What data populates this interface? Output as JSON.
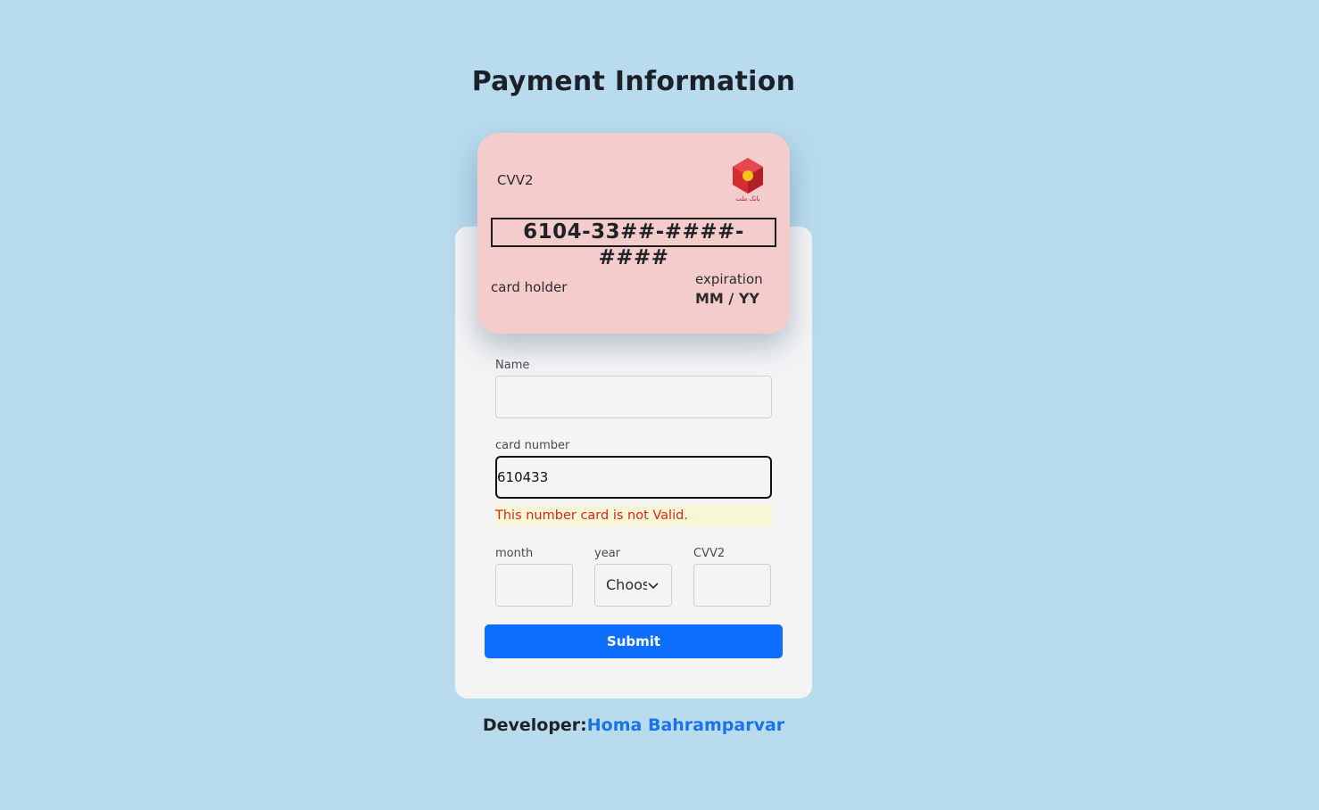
{
  "page": {
    "title": "Payment Information"
  },
  "card_preview": {
    "cvv_label": "CVV2",
    "number": "6104-33##-####-####",
    "holder": "card holder",
    "expiration_label": "expiration",
    "expiration_value": "MM / YY",
    "bank_logo_text": "بانک ملت"
  },
  "form": {
    "name": {
      "label": "Name",
      "value": ""
    },
    "card_number": {
      "label": "card number",
      "value": "610433"
    },
    "error": "This number card is not Valid.",
    "month": {
      "label": "month",
      "value": ""
    },
    "year": {
      "label": "year",
      "selected": "Choose"
    },
    "cvv": {
      "label": "CVV2",
      "value": ""
    },
    "submit_label": "Submit"
  },
  "footer": {
    "prefix": "Developer:",
    "developer_name": "Homa Bahramparvar"
  },
  "colors": {
    "background": "#b9dbee",
    "card": "#f5cccc",
    "panel": "#f4f4f5",
    "submit": "#0d6efd",
    "error_text": "#d9261c",
    "link": "#1a73e8"
  }
}
